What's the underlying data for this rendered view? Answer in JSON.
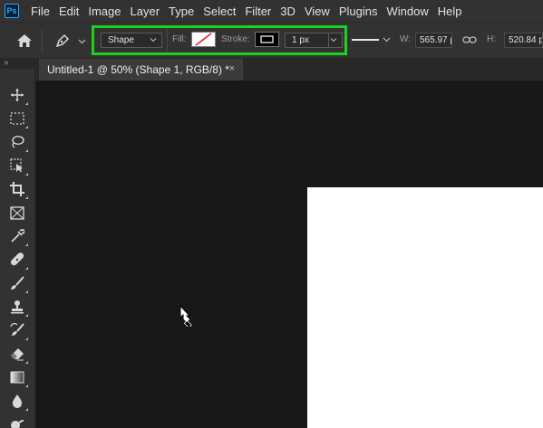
{
  "app": {
    "logo_text": "Ps"
  },
  "menu": [
    "File",
    "Edit",
    "Image",
    "Layer",
    "Type",
    "Select",
    "Filter",
    "3D",
    "View",
    "Plugins",
    "Window",
    "Help"
  ],
  "options": {
    "mode_value": "Shape",
    "fill_label": "Fill:",
    "stroke_label": "Stroke:",
    "stroke_width_value": "1 px",
    "w_label": "W:",
    "w_value": "565.97 p",
    "h_label": "H:",
    "h_value": "520.84 p"
  },
  "document": {
    "tab_title": "Untitled-1 @ 50% (Shape 1, RGB/8) *",
    "close_glyph": "×"
  },
  "colors": {
    "highlight": "#1fd11f",
    "fill_swatch_slash": "#e02020",
    "canvas": "#ffffff",
    "workspace": "#181818"
  },
  "tools": [
    "move-icon",
    "marquee-icon",
    "lasso-icon",
    "object-select-icon",
    "crop-icon",
    "frame-icon",
    "eyedropper-icon",
    "healing-brush-icon",
    "brush-icon",
    "clone-stamp-icon",
    "history-brush-icon",
    "eraser-icon",
    "gradient-icon",
    "blur-icon",
    "dodge-icon"
  ]
}
